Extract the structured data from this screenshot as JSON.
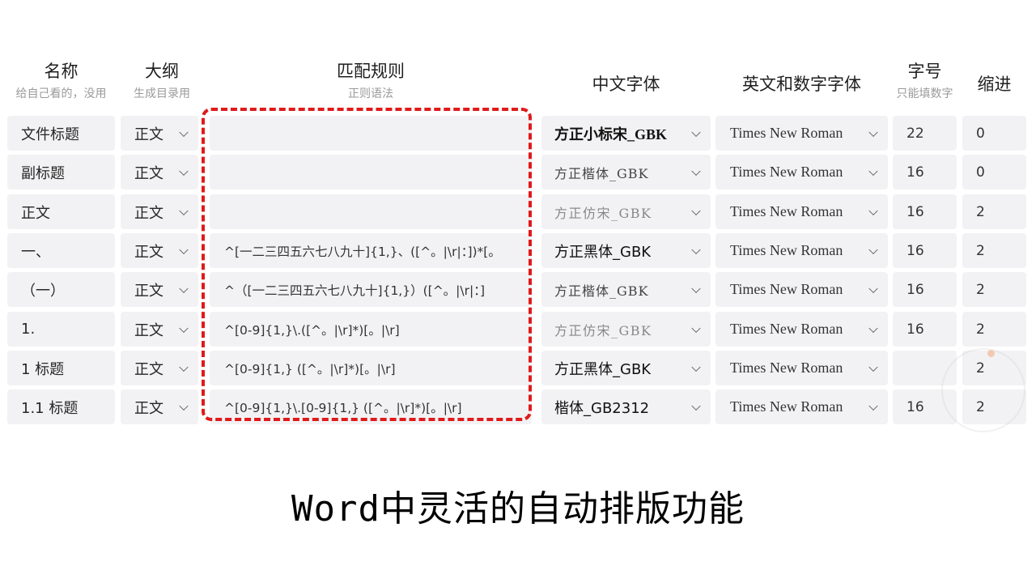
{
  "headers": {
    "name": {
      "title": "名称",
      "subtitle": "给自己看的，没用"
    },
    "outline": {
      "title": "大纲",
      "subtitle": "生成目录用"
    },
    "rule": {
      "title": "匹配规则",
      "subtitle": "正则语法"
    },
    "cn_font": {
      "title": "中文字体",
      "subtitle": ""
    },
    "en_font": {
      "title": "英文和数字字体",
      "subtitle": ""
    },
    "size": {
      "title": "字号",
      "subtitle": "只能填数字"
    },
    "indent": {
      "title": "缩进",
      "subtitle": ""
    }
  },
  "rows": [
    {
      "name": "文件标题",
      "outline": "正文",
      "rule": "",
      "cn_font": "方正小标宋_GBK",
      "en_font": "Times New Roman",
      "size": "22",
      "indent": "0"
    },
    {
      "name": "副标题",
      "outline": "正文",
      "rule": "",
      "cn_font": "方正楷体_GBK",
      "en_font": "Times New Roman",
      "size": "16",
      "indent": "0"
    },
    {
      "name": "正文",
      "outline": "正文",
      "rule": "",
      "cn_font": "方正仿宋_GBK",
      "en_font": "Times New Roman",
      "size": "16",
      "indent": "2"
    },
    {
      "name": "一、",
      "outline": "正文",
      "rule": "^[一二三四五六七八九十]{1,}、([^。|\\r|：])*[。",
      "cn_font": "方正黑体_GBK",
      "en_font": "Times New Roman",
      "size": "16",
      "indent": "2"
    },
    {
      "name": "（一）",
      "outline": "正文",
      "rule": "^（[一二三四五六七八九十]{1,}）([^。|\\r|：]",
      "cn_font": "方正楷体_GBK",
      "en_font": "Times New Roman",
      "size": "16",
      "indent": "2"
    },
    {
      "name": "1.",
      "outline": "正文",
      "rule": "^[0-9]{1,}\\.([^。|\\r]*)[。|\\r]",
      "cn_font": "方正仿宋_GBK",
      "en_font": "Times New Roman",
      "size": "16",
      "indent": "2"
    },
    {
      "name": "1 标题",
      "outline": "正文",
      "rule": "^[0-9]{1,} ([^。|\\r]*)[。|\\r]",
      "cn_font": "方正黑体_GBK",
      "en_font": "Times New Roman",
      "size": "",
      "indent": "2"
    },
    {
      "name": "1.1 标题",
      "outline": "正文",
      "rule": "^[0-9]{1,}\\.[0-9]{1,} ([^。|\\r]*)[。|\\r]",
      "cn_font": "楷体_GB2312",
      "en_font": "Times New Roman",
      "size": "16",
      "indent": "2"
    }
  ],
  "caption": "Word中灵活的自动排版功能",
  "colors": {
    "highlight": "#e01a1a",
    "cell_bg": "#f2f2f4"
  }
}
